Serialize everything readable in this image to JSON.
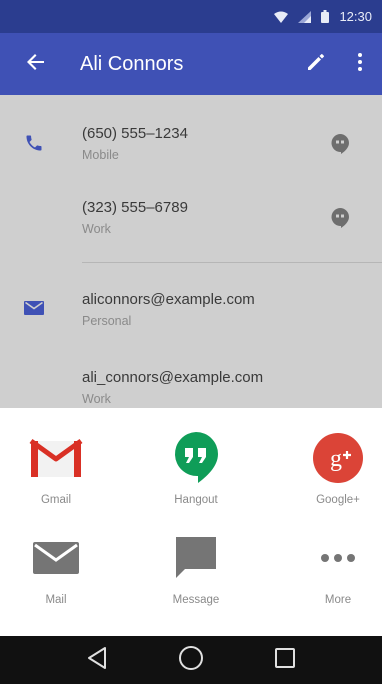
{
  "status_bar": {
    "time": "12:30"
  },
  "app_bar": {
    "title": "Ali Connors"
  },
  "contacts": {
    "phones": [
      {
        "number": "(650) 555–1234",
        "type": "Mobile"
      },
      {
        "number": "(323) 555–6789",
        "type": "Work"
      }
    ],
    "emails": [
      {
        "address": "aliconnors@example.com",
        "type": "Personal"
      },
      {
        "address": "ali_connors@example.com",
        "type": "Work"
      }
    ]
  },
  "share": {
    "items": [
      {
        "label": "Gmail",
        "icon": "gmail-icon"
      },
      {
        "label": "Hangout",
        "icon": "hangouts-icon"
      },
      {
        "label": "Google+",
        "icon": "google-plus-icon"
      },
      {
        "label": "Mail",
        "icon": "mail-icon"
      },
      {
        "label": "Message",
        "icon": "message-icon"
      },
      {
        "label": "More",
        "icon": "more-horizontal-icon"
      }
    ]
  },
  "colors": {
    "status_bar": "#2b3d8f",
    "app_bar": "#3f51b5",
    "accent_icon": "#3f51b5",
    "content_dim": "#cfcfcf",
    "hangouts_green": "#0f9d58",
    "google_plus_red": "#db4437",
    "gmail_red": "#d93025"
  }
}
